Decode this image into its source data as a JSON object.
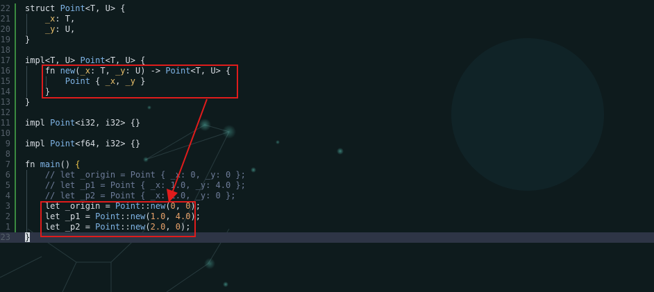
{
  "colors": {
    "background": "#0e1b1d",
    "current_line": "#2e3546",
    "annotation": "#e01c1c",
    "git_gutter": "#3b8a3f"
  },
  "lines": [
    {
      "num": "22",
      "tokens": [
        {
          "t": "struct ",
          "c": "kw"
        },
        {
          "t": "Point",
          "c": "ty"
        },
        {
          "t": "<T, U> {",
          "c": "kw"
        }
      ]
    },
    {
      "num": "21",
      "tokens": [
        {
          "t": "    ",
          "c": "kw"
        },
        {
          "t": "_x",
          "c": "fld"
        },
        {
          "t": ": T,",
          "c": "kw"
        }
      ]
    },
    {
      "num": "20",
      "tokens": [
        {
          "t": "    ",
          "c": "kw"
        },
        {
          "t": "_y",
          "c": "fld"
        },
        {
          "t": ": U,",
          "c": "kw"
        }
      ]
    },
    {
      "num": "19",
      "tokens": [
        {
          "t": "}",
          "c": "kw"
        }
      ]
    },
    {
      "num": "18",
      "tokens": []
    },
    {
      "num": "17",
      "tokens": [
        {
          "t": "impl<T, U> ",
          "c": "kw"
        },
        {
          "t": "Point",
          "c": "ty"
        },
        {
          "t": "<T, U> {",
          "c": "kw"
        }
      ]
    },
    {
      "num": "16",
      "tokens": [
        {
          "t": "    fn ",
          "c": "kw"
        },
        {
          "t": "new",
          "c": "ty"
        },
        {
          "t": "(",
          "c": "kw"
        },
        {
          "t": "_x",
          "c": "fld"
        },
        {
          "t": ": T, ",
          "c": "kw"
        },
        {
          "t": "_y",
          "c": "fld"
        },
        {
          "t": ": U) -> ",
          "c": "kw"
        },
        {
          "t": "Point",
          "c": "ty"
        },
        {
          "t": "<T, U> {",
          "c": "kw"
        }
      ]
    },
    {
      "num": "15",
      "tokens": [
        {
          "t": "        ",
          "c": "kw"
        },
        {
          "t": "Point",
          "c": "ty"
        },
        {
          "t": " { ",
          "c": "kw"
        },
        {
          "t": "_x",
          "c": "fld"
        },
        {
          "t": ", ",
          "c": "kw"
        },
        {
          "t": "_y",
          "c": "fld"
        },
        {
          "t": " }",
          "c": "kw"
        }
      ]
    },
    {
      "num": "14",
      "tokens": [
        {
          "t": "    }",
          "c": "kw"
        }
      ]
    },
    {
      "num": "13",
      "tokens": [
        {
          "t": "}",
          "c": "kw"
        }
      ]
    },
    {
      "num": "12",
      "tokens": []
    },
    {
      "num": "11",
      "tokens": [
        {
          "t": "impl ",
          "c": "kw"
        },
        {
          "t": "Point",
          "c": "ty"
        },
        {
          "t": "<i32, i32> {}",
          "c": "kw"
        }
      ]
    },
    {
      "num": "10",
      "tokens": []
    },
    {
      "num": "9",
      "tokens": [
        {
          "t": "impl ",
          "c": "kw"
        },
        {
          "t": "Point",
          "c": "ty"
        },
        {
          "t": "<f64, i32> {}",
          "c": "kw"
        }
      ]
    },
    {
      "num": "8",
      "tokens": []
    },
    {
      "num": "7",
      "tokens": [
        {
          "t": "fn ",
          "c": "kw"
        },
        {
          "t": "main",
          "c": "ty"
        },
        {
          "t": "() ",
          "c": "kw"
        },
        {
          "t": "{",
          "c": "br"
        }
      ]
    },
    {
      "num": "6",
      "tokens": [
        {
          "t": "    // let _origin = Point { _x: 0, _y: 0 };",
          "c": "cm"
        }
      ]
    },
    {
      "num": "5",
      "tokens": [
        {
          "t": "    // let _p1 = Point { _x: 1.0, _y: 4.0 };",
          "c": "cm"
        }
      ]
    },
    {
      "num": "4",
      "tokens": [
        {
          "t": "    // let _p2 = Point { _x: 2.0, _y: 0 };",
          "c": "cm"
        }
      ]
    },
    {
      "num": "3",
      "tokens": [
        {
          "t": "    let _origin = ",
          "c": "kw"
        },
        {
          "t": "Point",
          "c": "ty"
        },
        {
          "t": "::",
          "c": "kw"
        },
        {
          "t": "new",
          "c": "ty"
        },
        {
          "t": "(",
          "c": "kw"
        },
        {
          "t": "0",
          "c": "num"
        },
        {
          "t": ", ",
          "c": "kw"
        },
        {
          "t": "0",
          "c": "num"
        },
        {
          "t": ");",
          "c": "kw"
        }
      ]
    },
    {
      "num": "2",
      "tokens": [
        {
          "t": "    let _p1 = ",
          "c": "kw"
        },
        {
          "t": "Point",
          "c": "ty"
        },
        {
          "t": "::",
          "c": "kw"
        },
        {
          "t": "new",
          "c": "ty"
        },
        {
          "t": "(",
          "c": "kw"
        },
        {
          "t": "1.0",
          "c": "num"
        },
        {
          "t": ", ",
          "c": "kw"
        },
        {
          "t": "4.0",
          "c": "num"
        },
        {
          "t": ");",
          "c": "kw"
        }
      ]
    },
    {
      "num": "1",
      "tokens": [
        {
          "t": "    let _p2 = ",
          "c": "kw"
        },
        {
          "t": "Point",
          "c": "ty"
        },
        {
          "t": "::",
          "c": "kw"
        },
        {
          "t": "new",
          "c": "ty"
        },
        {
          "t": "(",
          "c": "kw"
        },
        {
          "t": "2.0",
          "c": "num"
        },
        {
          "t": ", ",
          "c": "kw"
        },
        {
          "t": "0",
          "c": "num"
        },
        {
          "t": ");",
          "c": "kw"
        }
      ]
    },
    {
      "num": "23",
      "tokens": [
        {
          "t": "}",
          "c": "cursor-ch"
        }
      ],
      "current": true
    }
  ]
}
